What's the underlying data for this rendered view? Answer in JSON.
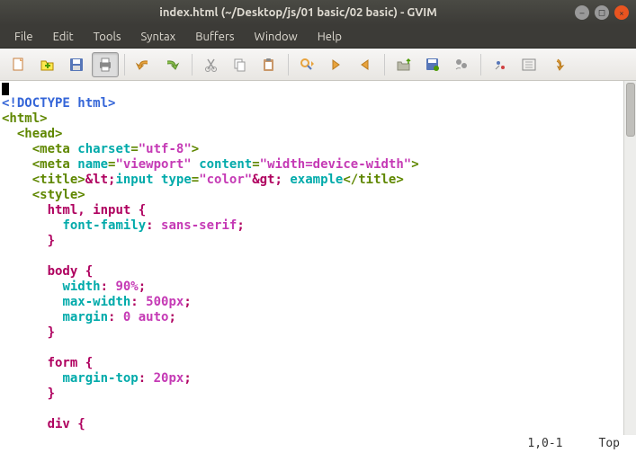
{
  "window": {
    "title": "index.html (~/Desktop/js/01 basic/02 basic) - GVIM"
  },
  "menubar": [
    "File",
    "Edit",
    "Tools",
    "Syntax",
    "Buffers",
    "Window",
    "Help"
  ],
  "toolbar_icons": [
    "new-file-icon",
    "open-file-icon",
    "save-icon",
    "print-icon",
    "sep",
    "undo-icon",
    "redo-icon",
    "sep",
    "cut-icon",
    "copy-icon",
    "paste-icon",
    "sep",
    "find-replace-icon",
    "find-next-icon",
    "find-prev-icon",
    "sep",
    "session-load-icon",
    "session-save-icon",
    "run-script-icon",
    "sep",
    "make-icon",
    "shell-icon",
    "tag-jump-icon"
  ],
  "code_tokens": [
    [
      {
        "cls": "cursor",
        "txt": ""
      }
    ],
    [
      {
        "cls": "doctype",
        "txt": "<!DOCTYPE html>"
      }
    ],
    [
      {
        "cls": "tag",
        "txt": "<html>"
      }
    ],
    [
      {
        "cls": "",
        "txt": "  "
      },
      {
        "cls": "tag",
        "txt": "<head>"
      }
    ],
    [
      {
        "cls": "",
        "txt": "    "
      },
      {
        "cls": "tag",
        "txt": "<meta "
      },
      {
        "cls": "attr",
        "txt": "charset"
      },
      {
        "cls": "tag",
        "txt": "="
      },
      {
        "cls": "str",
        "txt": "\"utf-8\""
      },
      {
        "cls": "tag",
        "txt": ">"
      }
    ],
    [
      {
        "cls": "",
        "txt": "    "
      },
      {
        "cls": "tag",
        "txt": "<meta "
      },
      {
        "cls": "attr",
        "txt": "name"
      },
      {
        "cls": "tag",
        "txt": "="
      },
      {
        "cls": "str",
        "txt": "\"viewport\""
      },
      {
        "cls": "tag",
        "txt": " "
      },
      {
        "cls": "attr",
        "txt": "content"
      },
      {
        "cls": "tag",
        "txt": "="
      },
      {
        "cls": "str",
        "txt": "\"width=device-width\""
      },
      {
        "cls": "tag",
        "txt": ">"
      }
    ],
    [
      {
        "cls": "",
        "txt": "    "
      },
      {
        "cls": "tag",
        "txt": "<title>"
      },
      {
        "cls": "kw",
        "txt": "&lt;"
      },
      {
        "cls": "attr",
        "txt": "input "
      },
      {
        "cls": "attr",
        "txt": "type"
      },
      {
        "cls": "tag",
        "txt": "="
      },
      {
        "cls": "str",
        "txt": "\"color\""
      },
      {
        "cls": "kw",
        "txt": "&gt;"
      },
      {
        "cls": "attr",
        "txt": " example"
      },
      {
        "cls": "tag",
        "txt": "</title>"
      }
    ],
    [
      {
        "cls": "",
        "txt": "    "
      },
      {
        "cls": "tag",
        "txt": "<style>"
      }
    ],
    [
      {
        "cls": "",
        "txt": "      "
      },
      {
        "cls": "kw",
        "txt": "html"
      },
      {
        "cls": "kw",
        "txt": ", "
      },
      {
        "cls": "kw",
        "txt": "input"
      },
      {
        "cls": "kw",
        "txt": " {"
      }
    ],
    [
      {
        "cls": "",
        "txt": "        "
      },
      {
        "cls": "kw2",
        "txt": "font-family"
      },
      {
        "cls": "kw",
        "txt": ": "
      },
      {
        "cls": "kw3",
        "txt": "sans-serif"
      },
      {
        "cls": "kw",
        "txt": ";"
      }
    ],
    [
      {
        "cls": "",
        "txt": "      "
      },
      {
        "cls": "kw",
        "txt": "}"
      }
    ],
    [
      {
        "cls": "",
        "txt": ""
      }
    ],
    [
      {
        "cls": "",
        "txt": "      "
      },
      {
        "cls": "kw",
        "txt": "body"
      },
      {
        "cls": "kw",
        "txt": " {"
      }
    ],
    [
      {
        "cls": "",
        "txt": "        "
      },
      {
        "cls": "kw2",
        "txt": "width"
      },
      {
        "cls": "kw",
        "txt": ": "
      },
      {
        "cls": "num",
        "txt": "90%"
      },
      {
        "cls": "kw",
        "txt": ";"
      }
    ],
    [
      {
        "cls": "",
        "txt": "        "
      },
      {
        "cls": "kw2",
        "txt": "max-width"
      },
      {
        "cls": "kw",
        "txt": ": "
      },
      {
        "cls": "num",
        "txt": "500px"
      },
      {
        "cls": "kw",
        "txt": ";"
      }
    ],
    [
      {
        "cls": "",
        "txt": "        "
      },
      {
        "cls": "kw2",
        "txt": "margin"
      },
      {
        "cls": "kw",
        "txt": ": "
      },
      {
        "cls": "num",
        "txt": "0"
      },
      {
        "cls": "kw",
        "txt": " "
      },
      {
        "cls": "kw3",
        "txt": "auto"
      },
      {
        "cls": "kw",
        "txt": ";"
      }
    ],
    [
      {
        "cls": "",
        "txt": "      "
      },
      {
        "cls": "kw",
        "txt": "}"
      }
    ],
    [
      {
        "cls": "",
        "txt": ""
      }
    ],
    [
      {
        "cls": "",
        "txt": "      "
      },
      {
        "cls": "kw",
        "txt": "form"
      },
      {
        "cls": "kw",
        "txt": " {"
      }
    ],
    [
      {
        "cls": "",
        "txt": "        "
      },
      {
        "cls": "kw2",
        "txt": "margin-top"
      },
      {
        "cls": "kw",
        "txt": ": "
      },
      {
        "cls": "num",
        "txt": "20px"
      },
      {
        "cls": "kw",
        "txt": ";"
      }
    ],
    [
      {
        "cls": "",
        "txt": "      "
      },
      {
        "cls": "kw",
        "txt": "}"
      }
    ],
    [
      {
        "cls": "",
        "txt": ""
      }
    ],
    [
      {
        "cls": "",
        "txt": "      "
      },
      {
        "cls": "kw",
        "txt": "div"
      },
      {
        "cls": "kw",
        "txt": " {"
      }
    ]
  ],
  "status": {
    "pos": "1,0-1",
    "scroll": "Top"
  }
}
